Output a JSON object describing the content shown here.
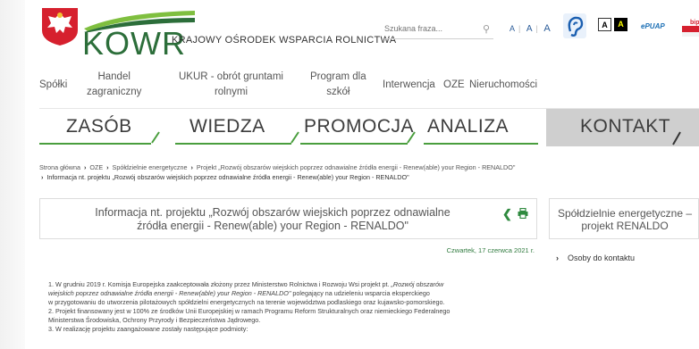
{
  "header": {
    "logo_text": "KOWR",
    "org_name": "KRAJOWY OŚRODEK WSPARCIA ROLNICTWA",
    "search_placeholder": "Szukana fraza...",
    "font_sizes": [
      "A",
      "A",
      "A"
    ],
    "contrast": [
      "A",
      "A"
    ],
    "epuap": "ePUAP",
    "bip": "bip"
  },
  "topnav": [
    {
      "label": "Spółki"
    },
    {
      "label": "Handel zagraniczny",
      "l1": "Handel",
      "l2": "zagraniczny"
    },
    {
      "label": "UKUR - obrót gruntami rolnymi",
      "l1": "UKUR - obrót gruntami",
      "l2": "rolnymi"
    },
    {
      "label": "Program dla szkół",
      "l1": "Program dla",
      "l2": "szkół"
    },
    {
      "label": "Interwencja"
    },
    {
      "label": "OZE"
    },
    {
      "label": "Nieruchomości"
    }
  ],
  "bignav": [
    "ZASÓB",
    "WIEDZA",
    "PROMOCJA",
    "ANALIZA",
    "KONTAKT"
  ],
  "breadcrumb": {
    "home": "Strona główna",
    "oze": "OZE",
    "coop": "Spółdzielnie energetyczne",
    "project": "Projekt „Rozwój obszarów wiejskich poprzez odnawialne źródła energii - Renew(able) your Region - RENALDO\"",
    "current": "Informacja nt. projektu „Rozwój obszarów wiejskich poprzez odnawialne źródła energii - Renew(able) your Region - RENALDO\""
  },
  "article": {
    "title_line1": "Informacja nt. projektu „Rozwój obszarów wiejskich poprzez odnawialne",
    "title_line2": "źródła energii - Renew(able) your Region - RENALDO\"",
    "date": "Czwartek, 17 czerwca 2021 r.",
    "p1_a": "1. W grudniu 2019 r. Komisja Europejska zaakceptowała złożony przez Ministerstwo Rolnictwa i Rozwoju Wsi projekt pt. ",
    "p1_i1": "„Rozwój obszarów",
    "p1_i2": "wiejskich poprzez odnawialne źródła energii - Renew(able) your Region - RENALDO\"",
    "p1_b": " polegający na udzieleniu wsparcia eksperckiego",
    "p1_c": "w przygotowaniu do utworzenia pilotażowych spółdzielni energetycznych na terenie województwa podlaskiego oraz kujawsko-pomorskiego.",
    "p2_a": "2. Projekt finansowany jest w 100% ze środków Unii Europejskiej w ramach Programu Reform Strukturalnych oraz niemieckiego Federalnego",
    "p2_b": "Ministerstwa Środowiska, Ochrony Przyrody i Bezpieczeństwa Jądrowego.",
    "p3": "3. W realizację projektu zaangażowane zostały następujące podmioty:"
  },
  "side": {
    "title_line1": "Spółdzielnie energetyczne –",
    "title_line2": "projekt RENALDO",
    "link": "Osoby do kontaktu"
  },
  "colors": {
    "green": "#4a9e3e",
    "dark_green": "#2c6e3a",
    "active_tab": "#cfcfcf"
  }
}
